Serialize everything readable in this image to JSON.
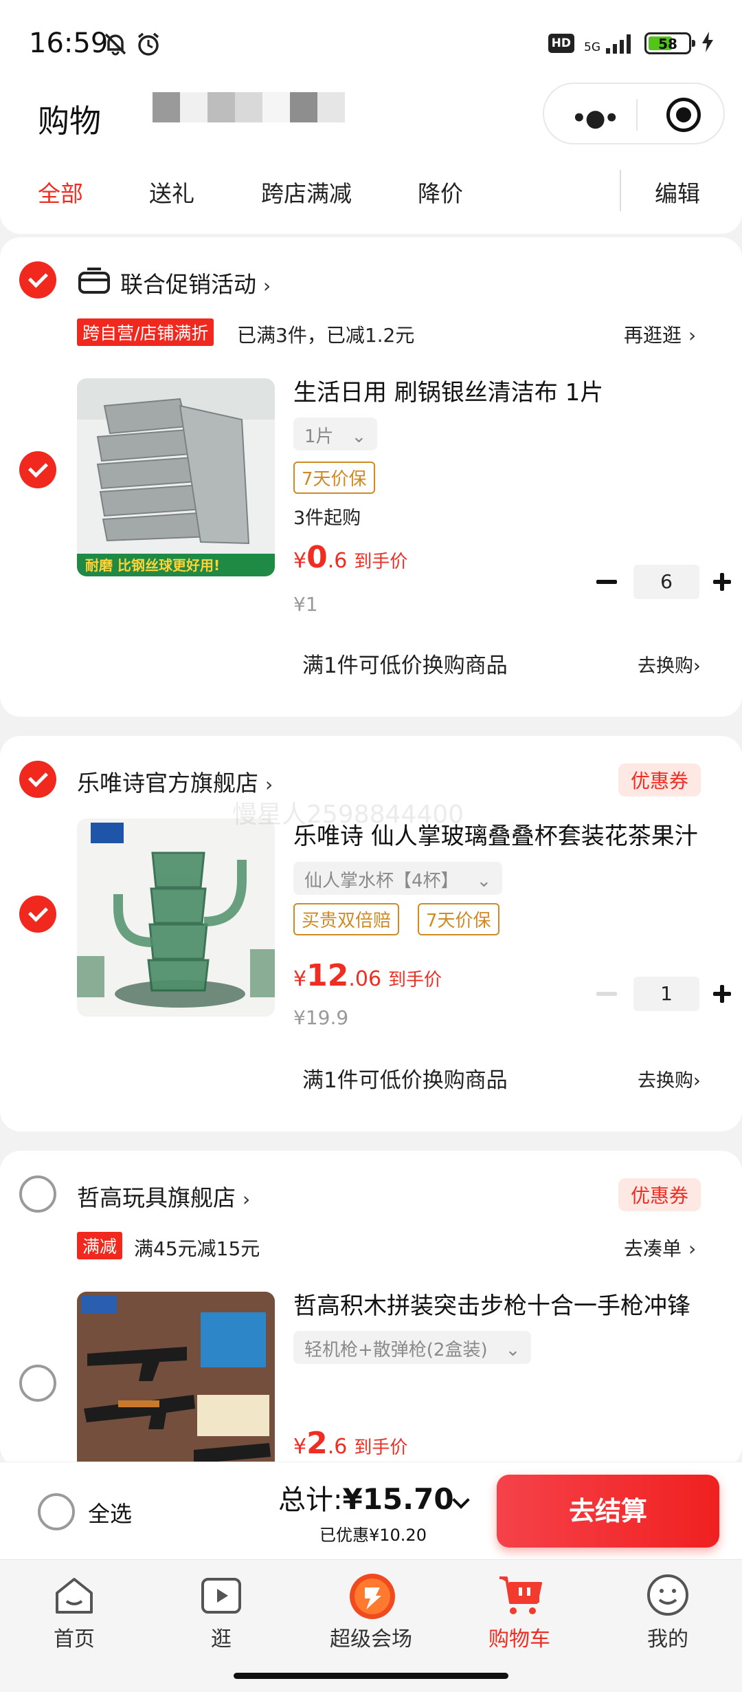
{
  "status_bar": {
    "time": "16:59",
    "network": "5G",
    "hd": "HD",
    "battery": "58"
  },
  "header": {
    "title": "购物",
    "tabs": [
      "全部",
      "送礼",
      "跨店满减",
      "降价"
    ],
    "edit_label": "编辑"
  },
  "group1": {
    "title": "联合促销活动",
    "promo_tag": "跨自营/店铺满折",
    "promo_text": "已满3件，已减1.2元",
    "promo_link": "再逛逛",
    "item": {
      "name": "生活日用 刷锅银丝清洁布 1片",
      "sku": "1片",
      "tags": [
        "7天价保"
      ],
      "min_buy": "3件起购",
      "price_int": "0",
      "price_dec": ".6",
      "price_label": "到手价",
      "currency": "¥",
      "original_price": "¥1",
      "quantity": "6",
      "image_caption": "耐磨 比钢丝球更好用!"
    },
    "swap_text": "满1件可低价换购商品",
    "swap_link": "去换购"
  },
  "group2": {
    "shop_name": "乐唯诗官方旗舰店",
    "coupon": "优惠券",
    "item": {
      "name": "乐唯诗 仙人掌玻璃叠叠杯套装花茶果汁",
      "sku": "仙人掌水杯【4杯】",
      "tags": [
        "买贵双倍赔",
        "7天价保"
      ],
      "price_int": "12",
      "price_dec": ".06",
      "price_label": "到手价",
      "currency": "¥",
      "original_price": "¥19.9",
      "quantity": "1"
    },
    "swap_text": "满1件可低价换购商品",
    "swap_link": "去换购"
  },
  "group3": {
    "shop_name": "哲高玩具旗舰店",
    "coupon": "优惠券",
    "promo_tag": "满减",
    "promo_text": "满45元减15元",
    "promo_link": "去凑单",
    "item": {
      "name": "哲高积木拼装突击步枪十合一手枪冲锋",
      "sku": "轻机枪+散弹枪(2盒装)",
      "price_int": "2",
      "price_dec": ".6",
      "price_label": "到手价",
      "currency": "¥"
    }
  },
  "watermark": "慢星人2598844400",
  "checkout": {
    "select_all": "全选",
    "total_label": "总计:",
    "total_value": "¥15.70",
    "saved": "已优惠¥10.20",
    "pay_button": "去结算"
  },
  "tabbar": [
    {
      "label": "首页",
      "icon": "home-icon"
    },
    {
      "label": "逛",
      "icon": "video-icon"
    },
    {
      "label": "超级会场",
      "icon": "super-venue-icon"
    },
    {
      "label": "购物车",
      "icon": "cart-icon",
      "active": true
    },
    {
      "label": "我的",
      "icon": "profile-icon"
    }
  ],
  "colors": {
    "accent": "#f02d22",
    "tag_gold": "#d08a24",
    "background": "#f2f2f2"
  }
}
